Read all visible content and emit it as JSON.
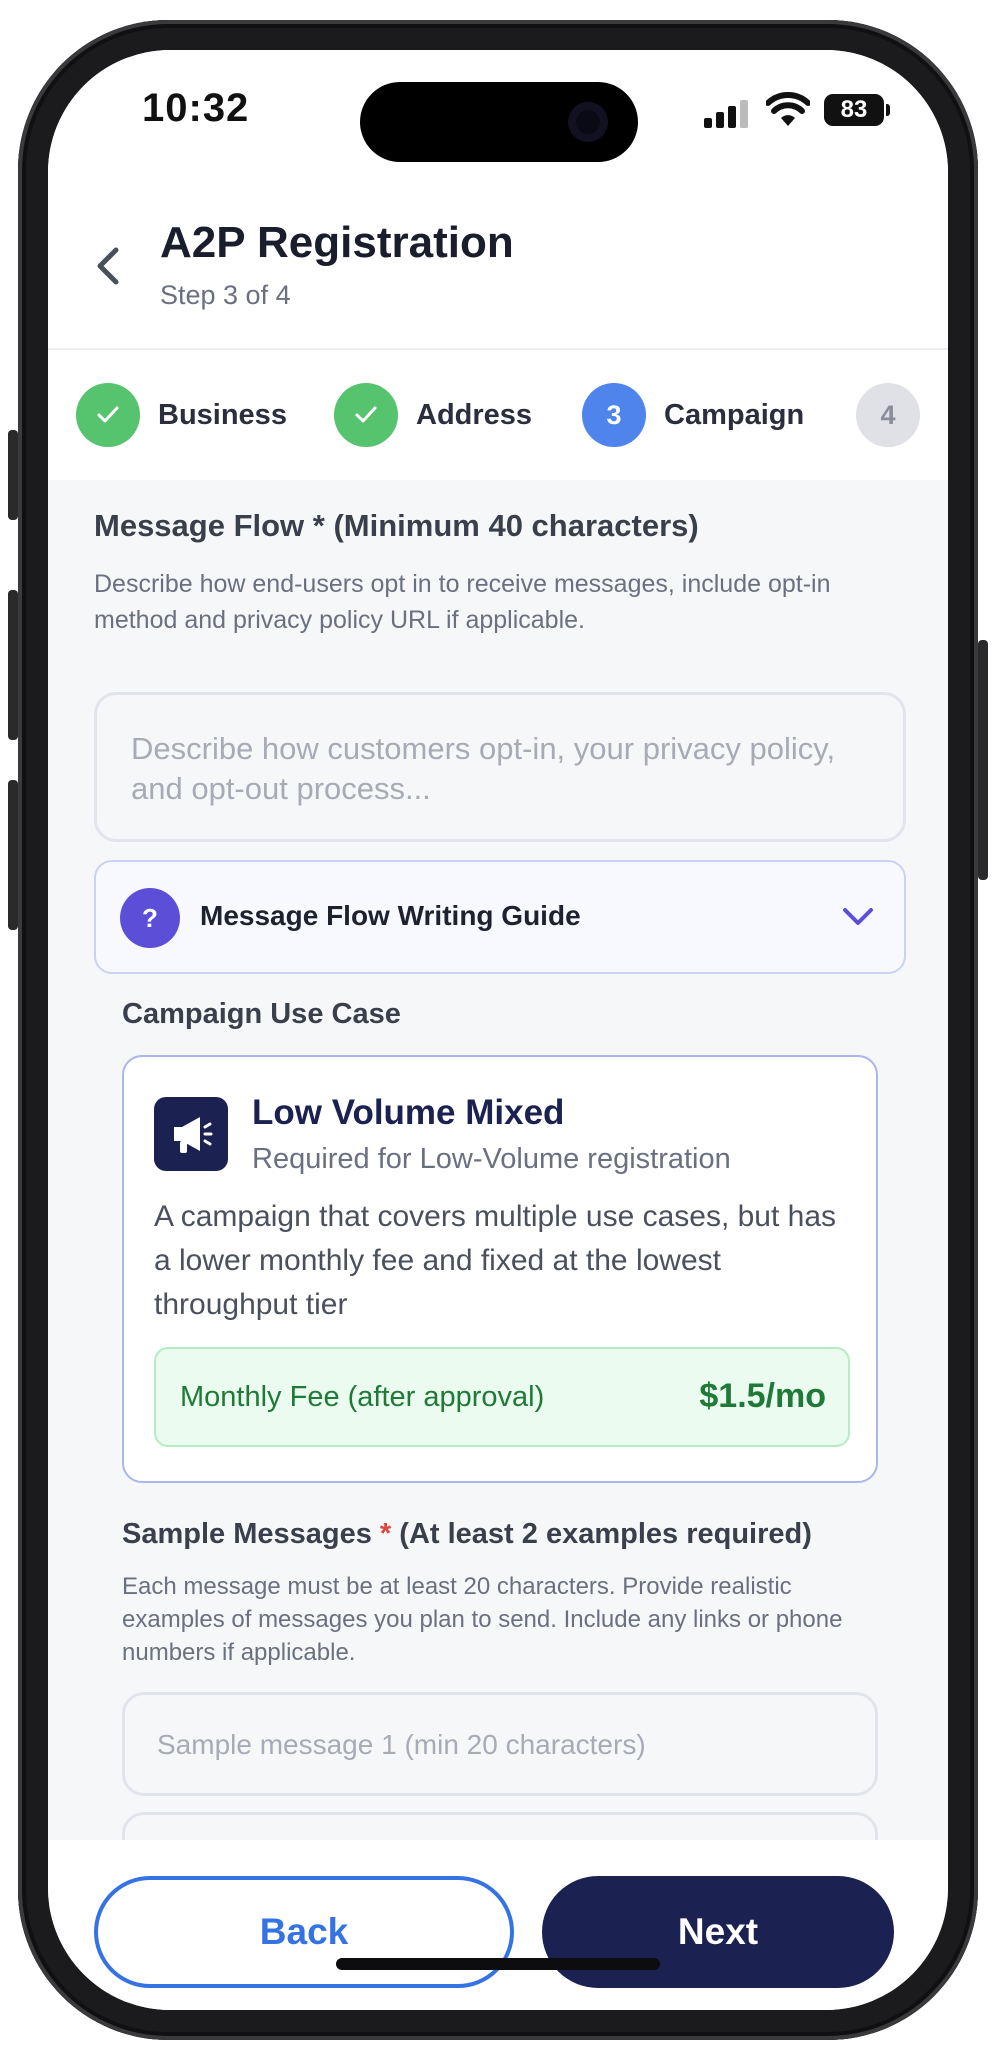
{
  "status_bar": {
    "time": "10:32",
    "battery": "83"
  },
  "header": {
    "title": "A2P Registration",
    "subtitle": "Step 3 of 4"
  },
  "stepper": {
    "steps": [
      {
        "label": "Business",
        "state": "done"
      },
      {
        "label": "Address",
        "state": "done"
      },
      {
        "label": "Campaign",
        "state": "current",
        "number": "3"
      },
      {
        "label": "",
        "state": "upcoming",
        "number": "4"
      }
    ]
  },
  "message_flow": {
    "label": "Message Flow * (Minimum 40 characters)",
    "help": "Describe how end-users opt in to receive messages, include opt-in method and privacy policy URL if applicable.",
    "placeholder": "Describe how customers opt-in, your privacy policy, and opt-out process..."
  },
  "guide": {
    "label": "Message Flow Writing Guide",
    "icon_text": "?"
  },
  "use_case": {
    "section_label": "Campaign Use Case",
    "title": "Low Volume Mixed",
    "subtitle": "Required for Low-Volume registration",
    "description": "A campaign that covers multiple use cases, but has a lower monthly fee and fixed at the lowest throughput tier",
    "fee_label": "Monthly Fee (after approval)",
    "fee_value": "$1.5/mo"
  },
  "sample_messages": {
    "label": "Sample Messages",
    "required_mark": "*",
    "label_suffix": "(At least 2 examples required)",
    "help": "Each message must be at least 20 characters. Provide realistic examples of messages you plan to send. Include any links or phone numbers if applicable.",
    "placeholder_1": "Sample message 1 (min 20 characters)"
  },
  "footer": {
    "back_label": "Back",
    "next_label": "Next"
  },
  "colors": {
    "primary": "#3572e4",
    "navy": "#1b2150",
    "success": "#56c36e",
    "current_step": "#4f84ec",
    "required": "#e0453a"
  }
}
